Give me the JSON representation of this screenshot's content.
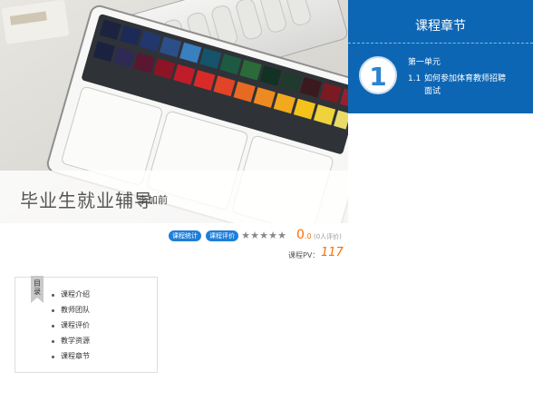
{
  "course": {
    "title": "毕业生就业辅导",
    "author": "李加前"
  },
  "sidebar": {
    "title": "课程章节",
    "unit_number": "1",
    "unit_name": "第一单元",
    "lesson_number": "1.1",
    "lesson_title": "如何参加体育教师招聘面试"
  },
  "meta": {
    "stats_label": "课程统计",
    "review_label": "课程评价",
    "rating_stars": 5,
    "rating_value": "0",
    "rating_decimal": ".0",
    "review_count": "(0人评价)",
    "pv_label": "课程PV：",
    "pv_value": "117"
  },
  "toc": {
    "label": "目录",
    "items": [
      "课程介绍",
      "教师团队",
      "课程评价",
      "教学资源",
      "课程章节"
    ]
  },
  "colors": {
    "primary": "#0d66b4",
    "badge": "#1e7ed8",
    "accent": "#ff6b00"
  }
}
